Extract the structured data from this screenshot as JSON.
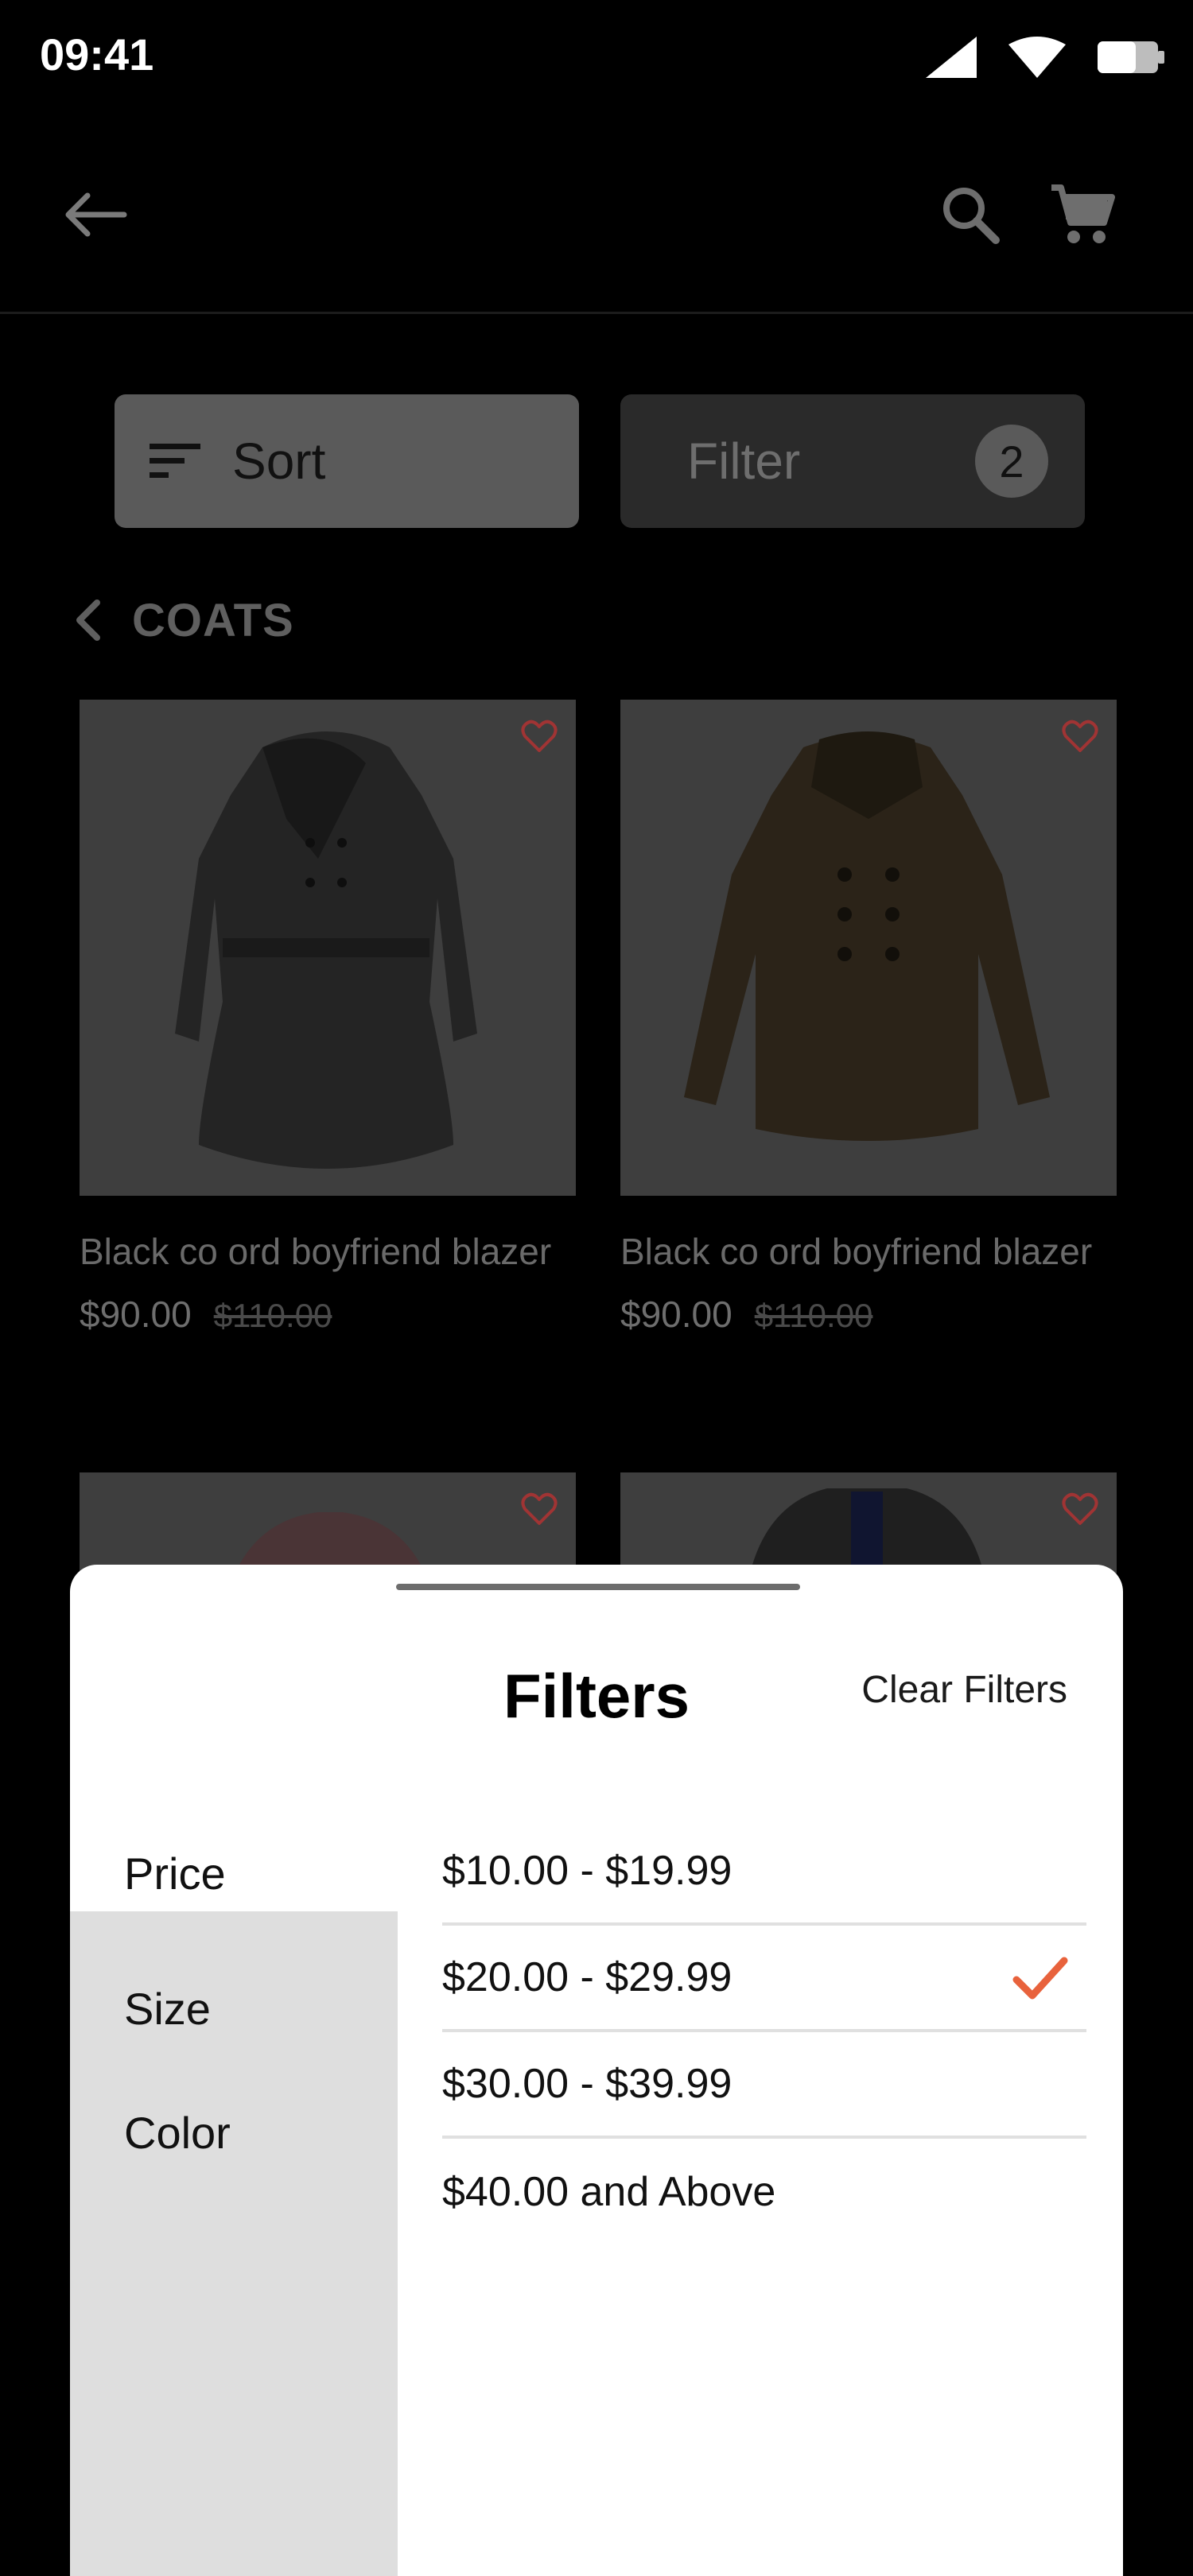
{
  "status_bar": {
    "time": "09:41",
    "icons": [
      "signal-icon",
      "wifi-icon",
      "battery-icon"
    ]
  },
  "app_bar": {
    "icons": [
      "back-arrow-icon",
      "search-icon",
      "cart-icon"
    ]
  },
  "toolbar": {
    "sort_label": "Sort",
    "filter_label": "Filter",
    "filter_count": "2"
  },
  "breadcrumb": {
    "label": "COATS"
  },
  "products": [
    {
      "name": "Black co ord  boyfriend blazer",
      "price": "$90.00",
      "old_price": "$110.00"
    },
    {
      "name": "Black co ord  boyfriend blazer",
      "price": "$90.00",
      "old_price": "$110.00"
    }
  ],
  "filter_sheet": {
    "title": "Filters",
    "clear_label": "Clear Filters",
    "categories": [
      "Price",
      "Size",
      "Color"
    ],
    "selected_category": "Price",
    "options": [
      {
        "label": "$10.00 - $19.99",
        "checked": false
      },
      {
        "label": "$20.00 - $29.99",
        "checked": true
      },
      {
        "label": "$30.00 - $39.99",
        "checked": false
      },
      {
        "label": "$40.00 and Above",
        "checked": false
      }
    ]
  },
  "colors": {
    "accent": "#e8623c",
    "heart": "#a03434",
    "sheet_bg": "#ffffff",
    "category_panel": "#dedede"
  }
}
